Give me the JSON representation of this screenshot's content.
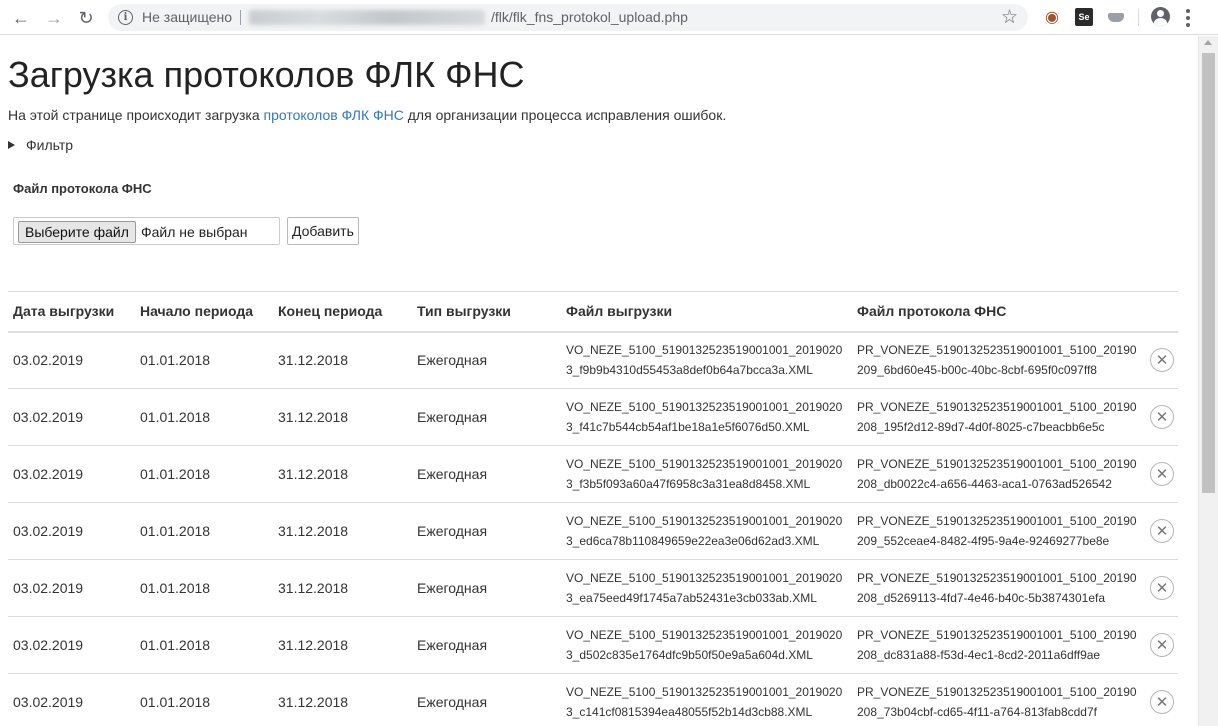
{
  "browser": {
    "security_text": "Не защищено",
    "url_path": "/flk/flk_fns_protokol_upload.php",
    "ext_se_label": "Se"
  },
  "page": {
    "title": "Загрузка протоколов ФЛК ФНС",
    "intro_before": "На этой странице происходит загрузка ",
    "intro_link": "протоколов ФЛК ФНС",
    "intro_after": " для организации процесса исправления ошибок.",
    "filter_label": "Фильтр"
  },
  "upload": {
    "label": "Файл протокола ФНС",
    "choose_button": "Выберите файл",
    "no_file_text": "Файл не выбран",
    "add_button": "Добавить"
  },
  "table": {
    "headers": [
      "Дата выгрузки",
      "Начало периода",
      "Конец периода",
      "Тип выгрузки",
      "Файл выгрузки",
      "Файл протокола ФНС"
    ],
    "rows": [
      {
        "date": "03.02.2019",
        "start": "01.01.2018",
        "end": "31.12.2018",
        "type": "Ежегодная",
        "file": "VO_NEZE_5100_5190132523519001001_20190203_f9b9b4310d55453a8def0b64a7bcca3a.XML",
        "protocol": "PR_VONEZE_5190132523519001001_5100_20190209_6bd60e45-b00c-40bc-8cbf-695f0c097ff8"
      },
      {
        "date": "03.02.2019",
        "start": "01.01.2018",
        "end": "31.12.2018",
        "type": "Ежегодная",
        "file": "VO_NEZE_5100_5190132523519001001_20190203_f41c7b544cb54af1be18a1e5f6076d50.XML",
        "protocol": "PR_VONEZE_5190132523519001001_5100_20190208_195f2d12-89d7-4d0f-8025-c7beacbb6e5c"
      },
      {
        "date": "03.02.2019",
        "start": "01.01.2018",
        "end": "31.12.2018",
        "type": "Ежегодная",
        "file": "VO_NEZE_5100_5190132523519001001_20190203_f3b5f093a60a47f6958c3a31ea8d8458.XML",
        "protocol": "PR_VONEZE_5190132523519001001_5100_20190208_db0022c4-a656-4463-aca1-0763ad526542"
      },
      {
        "date": "03.02.2019",
        "start": "01.01.2018",
        "end": "31.12.2018",
        "type": "Ежегодная",
        "file": "VO_NEZE_5100_5190132523519001001_20190203_ed6ca78b110849659e22ea3e06d62ad3.XML",
        "protocol": "PR_VONEZE_5190132523519001001_5100_20190209_552ceae4-8482-4f95-9a4e-92469277be8e"
      },
      {
        "date": "03.02.2019",
        "start": "01.01.2018",
        "end": "31.12.2018",
        "type": "Ежегодная",
        "file": "VO_NEZE_5100_5190132523519001001_20190203_ea75eed49f1745a7ab52431e3cb033ab.XML",
        "protocol": "PR_VONEZE_5190132523519001001_5100_20190208_d5269113-4fd7-4e46-b40c-5b3874301efa"
      },
      {
        "date": "03.02.2019",
        "start": "01.01.2018",
        "end": "31.12.2018",
        "type": "Ежегодная",
        "file": "VO_NEZE_5100_5190132523519001001_20190203_d502c835e1764dfc9b50f50e9a5a604d.XML",
        "protocol": "PR_VONEZE_5190132523519001001_5100_20190208_dc831a88-f53d-4ec1-8cd2-2011a6dff9ae"
      },
      {
        "date": "03.02.2019",
        "start": "01.01.2018",
        "end": "31.12.2018",
        "type": "Ежегодная",
        "file": "VO_NEZE_5100_5190132523519001001_20190203_c141cf0815394ea48055f52b14d3cb88.XML",
        "protocol": "PR_VONEZE_5190132523519001001_5100_20190208_73b04cbf-cd65-4f11-a764-813fab8cdd7f"
      }
    ]
  },
  "colors": {
    "link": "#337ab7",
    "text": "#333333",
    "border": "#dddddd"
  }
}
